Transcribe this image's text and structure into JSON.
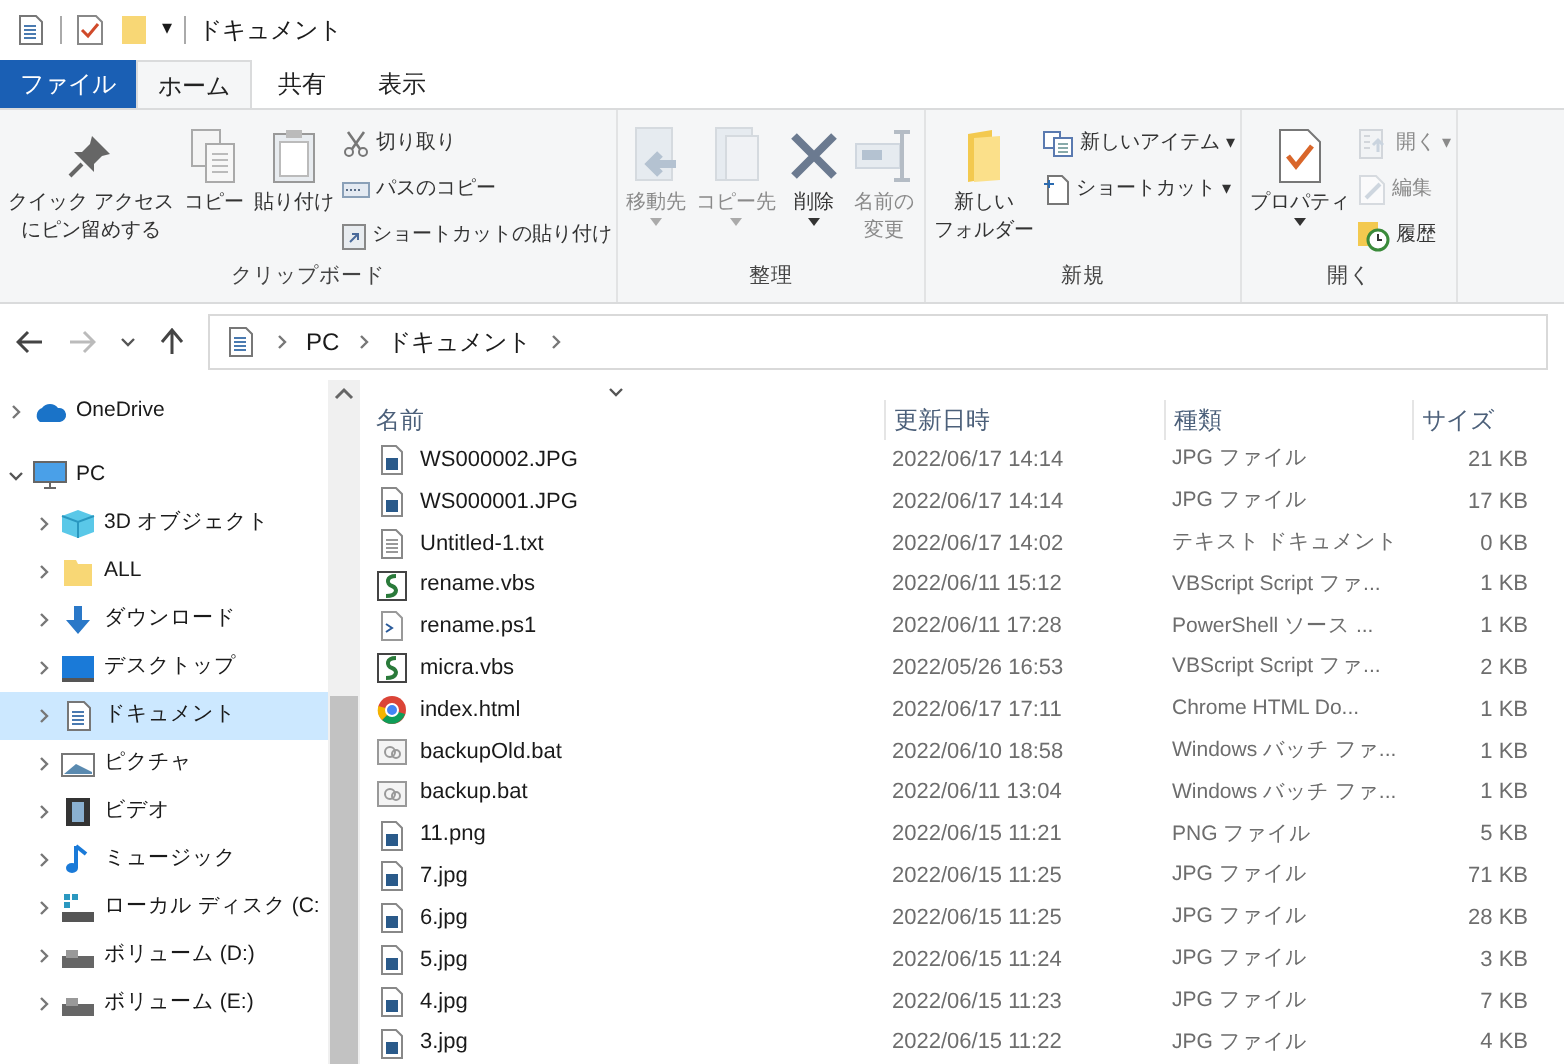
{
  "window": {
    "title": "ドキュメント",
    "quick_access_arrow": "▾"
  },
  "ribbon_tabs": [
    {
      "label": "ファイル",
      "kind": "file",
      "selected": false
    },
    {
      "label": "ホーム",
      "kind": "tab",
      "selected": true
    },
    {
      "label": "共有",
      "kind": "tab",
      "selected": false
    },
    {
      "label": "表示",
      "kind": "tab",
      "selected": false
    }
  ],
  "ribbon_groups": [
    {
      "label": "クリップボード",
      "large": [
        {
          "lines": [
            "クイック アクセス",
            "にピン留めする"
          ],
          "kind": "pin",
          "disabled": false
        },
        {
          "lines": [
            "コピー"
          ],
          "kind": "copy",
          "disabled": false
        },
        {
          "lines": [
            "貼り付け"
          ],
          "kind": "paste",
          "disabled": false
        }
      ],
      "small": [
        {
          "label": "切り取り",
          "kind": "scissors",
          "disabled": false
        },
        {
          "label": "パスのコピー",
          "kind": "path",
          "disabled": false
        },
        {
          "label": "ショートカットの貼り付け",
          "kind": "shortcut-paste",
          "disabled": false
        }
      ]
    },
    {
      "label": "整理",
      "large": [
        {
          "lines": [
            "移動先"
          ],
          "kind": "move",
          "disabled": true,
          "dropdown": true
        },
        {
          "lines": [
            "コピー先"
          ],
          "kind": "copyto",
          "disabled": true,
          "dropdown": true
        },
        {
          "lines": [
            "削除"
          ],
          "kind": "delete",
          "disabled": false,
          "dropdown": true
        },
        {
          "lines": [
            "名前の",
            "変更"
          ],
          "kind": "rename",
          "disabled": true
        }
      ]
    },
    {
      "label": "新規",
      "large": [
        {
          "lines": [
            "新しい",
            "フォルダー"
          ],
          "kind": "folder",
          "disabled": false
        }
      ],
      "small": [
        {
          "label": "新しいアイテム",
          "kind": "new-item",
          "disabled": false,
          "arrow": "▾"
        },
        {
          "label": "ショートカット",
          "kind": "shortcut",
          "disabled": false,
          "arrow": "▾"
        }
      ]
    },
    {
      "label": "開く",
      "large": [
        {
          "lines": [
            "プロパティ"
          ],
          "kind": "properties",
          "disabled": false,
          "dropdown": true
        }
      ],
      "small": [
        {
          "label": "開く",
          "kind": "open",
          "disabled": true,
          "arrow": "▾"
        },
        {
          "label": "編集",
          "kind": "edit",
          "disabled": true
        },
        {
          "label": "履歴",
          "kind": "history",
          "disabled": false
        }
      ]
    }
  ],
  "address_bar": {
    "path": [
      "PC",
      "ドキュメント"
    ]
  },
  "sidebar": {
    "items": [
      {
        "label": "OneDrive",
        "kind": "cloud",
        "expanded": false,
        "selected": false
      },
      {
        "label": "PC",
        "kind": "pc",
        "expanded": true,
        "selected": false,
        "children": [
          {
            "label": "3D オブジェクト",
            "kind": "cube",
            "expanded": false,
            "selected": false
          },
          {
            "label": "ALL",
            "kind": "folder",
            "expanded": false,
            "selected": false
          },
          {
            "label": "ダウンロード",
            "kind": "download",
            "expanded": false,
            "selected": false
          },
          {
            "label": "デスクトップ",
            "kind": "desktop",
            "expanded": false,
            "selected": false
          },
          {
            "label": "ドキュメント",
            "kind": "document",
            "expanded": false,
            "selected": true
          },
          {
            "label": "ピクチャ",
            "kind": "picture",
            "expanded": false,
            "selected": false
          },
          {
            "label": "ビデオ",
            "kind": "video",
            "expanded": false,
            "selected": false
          },
          {
            "label": "ミュージック",
            "kind": "music",
            "expanded": false,
            "selected": false
          },
          {
            "label": "ローカル ディスク (C:",
            "kind": "system-drive",
            "expanded": false,
            "selected": false
          },
          {
            "label": "ボリューム (D:)",
            "kind": "drive",
            "expanded": false,
            "selected": false
          },
          {
            "label": "ボリューム (E:)",
            "kind": "drive",
            "expanded": false,
            "selected": false
          }
        ]
      }
    ]
  },
  "file_list": {
    "columns": [
      "名前",
      "更新日時",
      "種類",
      "サイズ"
    ],
    "rows": [
      {
        "name": "WS000002.JPG",
        "kind": "image",
        "modified": "2022/06/17 14:14",
        "type": "JPG ファイル",
        "size": "21 KB"
      },
      {
        "name": "WS000001.JPG",
        "kind": "image",
        "modified": "2022/06/17 14:14",
        "type": "JPG ファイル",
        "size": "17 KB"
      },
      {
        "name": "Untitled-1.txt",
        "kind": "text",
        "modified": "2022/06/17 14:02",
        "type": "テキスト ドキュメント",
        "size": "0 KB"
      },
      {
        "name": "rename.vbs",
        "kind": "script",
        "modified": "2022/06/11 15:12",
        "type": "VBScript Script ファ...",
        "size": "1 KB"
      },
      {
        "name": "rename.ps1",
        "kind": "powershell",
        "modified": "2022/06/11 17:28",
        "type": "PowerShell ソース ...",
        "size": "1 KB"
      },
      {
        "name": "micra.vbs",
        "kind": "script",
        "modified": "2022/05/26 16:53",
        "type": "VBScript Script ファ...",
        "size": "2 KB"
      },
      {
        "name": "index.html",
        "kind": "browser",
        "modified": "2022/06/17 17:11",
        "type": "Chrome HTML Do...",
        "size": "1 KB"
      },
      {
        "name": "backupOld.bat",
        "kind": "batch",
        "modified": "2022/06/10 18:58",
        "type": "Windows バッチ ファ...",
        "size": "1 KB"
      },
      {
        "name": "backup.bat",
        "kind": "batch",
        "modified": "2022/06/11 13:04",
        "type": "Windows バッチ ファ...",
        "size": "1 KB"
      },
      {
        "name": "11.png",
        "kind": "image",
        "modified": "2022/06/15 11:21",
        "type": "PNG ファイル",
        "size": "5 KB"
      },
      {
        "name": "7.jpg",
        "kind": "image",
        "modified": "2022/06/15 11:25",
        "type": "JPG ファイル",
        "size": "71 KB"
      },
      {
        "name": "6.jpg",
        "kind": "image",
        "modified": "2022/06/15 11:25",
        "type": "JPG ファイル",
        "size": "28 KB"
      },
      {
        "name": "5.jpg",
        "kind": "image",
        "modified": "2022/06/15 11:24",
        "type": "JPG ファイル",
        "size": "3 KB"
      },
      {
        "name": "4.jpg",
        "kind": "image",
        "modified": "2022/06/15 11:23",
        "type": "JPG ファイル",
        "size": "7 KB"
      },
      {
        "name": "3.jpg",
        "kind": "image",
        "modified": "2022/06/15 11:22",
        "type": "JPG ファイル",
        "size": "4 KB"
      }
    ]
  }
}
